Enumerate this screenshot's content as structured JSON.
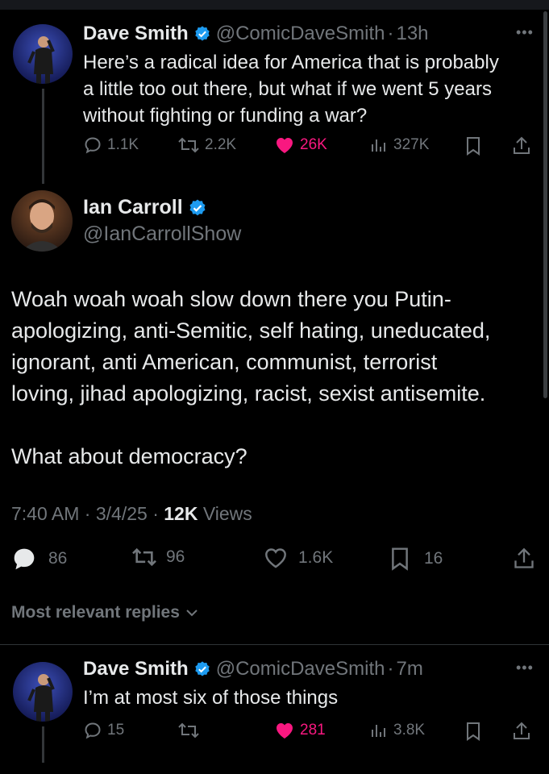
{
  "tweet1": {
    "name": "Dave Smith",
    "handle": "@ComicDaveSmith",
    "time": "13h",
    "text_lines": [
      "Here’s a radical idea for America that is probably",
      "a little too out there, but what if we went 5 years",
      "without fighting or funding a war?"
    ],
    "replies": "1.1K",
    "retweets": "2.2K",
    "likes": "26K",
    "views": "327K"
  },
  "main": {
    "name": "Ian Carroll",
    "handle": "@IanCarrollShow",
    "text_lines": [
      "Woah woah woah slow down there you Putin-",
      "apologizing, anti-Semitic, self hating, uneducated,",
      "ignorant, anti American, communist, terrorist",
      "loving, jihad apologizing, racist, sexist antisemite."
    ],
    "text_line2": "What about democracy?",
    "time": "7:40 AM",
    "date": "3/4/25",
    "views_count": "12K",
    "views_label": "Views",
    "replies": "86",
    "retweets": "96",
    "likes": "1.6K",
    "bookmarks": "16"
  },
  "replies_sort_label": "Most relevant replies",
  "tweet2": {
    "name": "Dave Smith",
    "handle": "@ComicDaveSmith",
    "time": "7m",
    "text": "I’m at most six of those things",
    "replies": "15",
    "likes": "281",
    "views": "3.8K"
  },
  "colors": {
    "background": "#000000",
    "text": "#e7e9ea",
    "muted": "#71767b",
    "like": "#f91880",
    "verified": "#1d9bf0"
  }
}
